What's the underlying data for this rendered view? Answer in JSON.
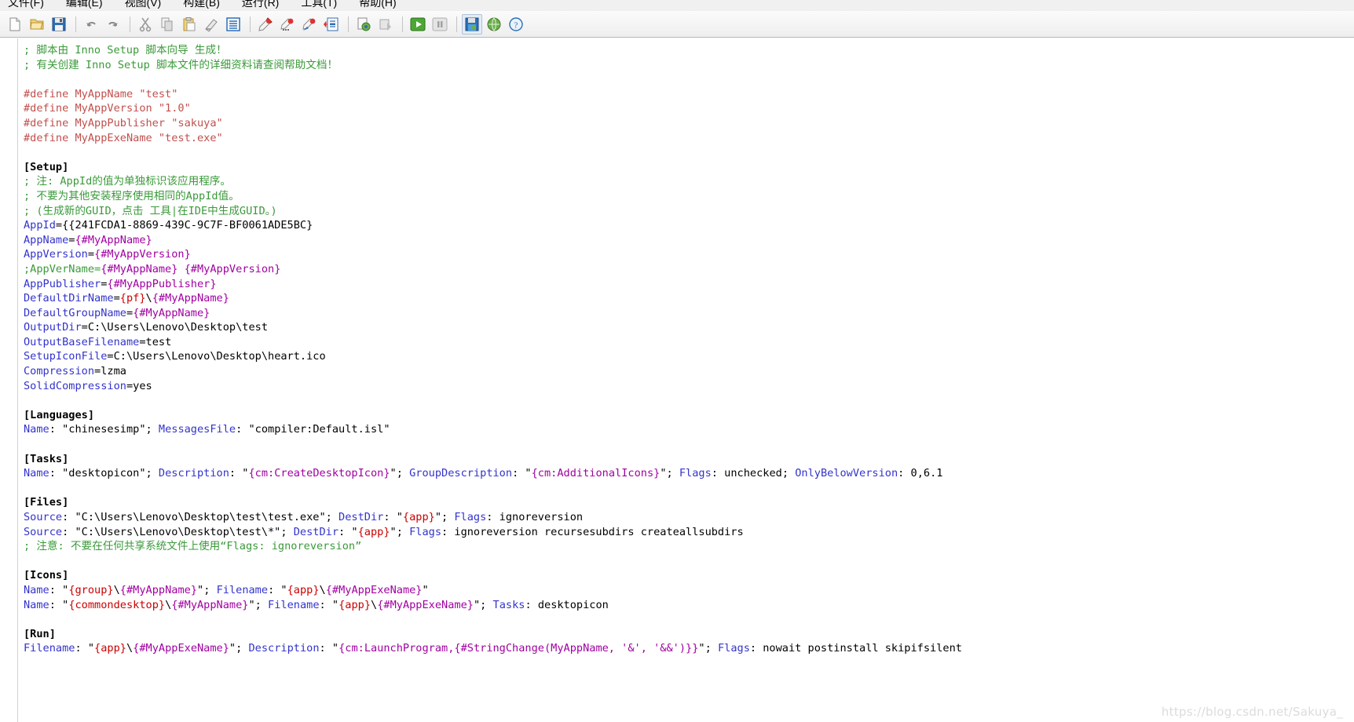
{
  "menubar": {
    "items": [
      {
        "name": "file",
        "label": "文件(F)"
      },
      {
        "name": "edit",
        "label": "编辑(E)"
      },
      {
        "name": "view",
        "label": "视图(V)"
      },
      {
        "name": "build",
        "label": "构建(B)"
      },
      {
        "name": "run",
        "label": "运行(R)"
      },
      {
        "name": "tools",
        "label": "工具(T)"
      },
      {
        "name": "help",
        "label": "帮助(H)"
      }
    ]
  },
  "toolbar": {
    "buttons": [
      {
        "name": "new-file-icon",
        "tip": "新建"
      },
      {
        "name": "open-folder-icon",
        "tip": "打开"
      },
      {
        "name": "save-icon",
        "tip": "保存"
      },
      {
        "name": "undo-icon",
        "tip": "撤销"
      },
      {
        "name": "redo-icon",
        "tip": "重做"
      },
      {
        "name": "cut-icon",
        "tip": "剪切"
      },
      {
        "name": "copy-icon",
        "tip": "复制"
      },
      {
        "name": "paste-icon",
        "tip": "粘贴"
      },
      {
        "name": "erase-icon",
        "tip": "删除"
      },
      {
        "name": "select-all-icon",
        "tip": "全选"
      },
      {
        "name": "find-icon",
        "tip": "查找"
      },
      {
        "name": "find-next-icon",
        "tip": "查找下一个"
      },
      {
        "name": "replace-icon",
        "tip": "替换"
      },
      {
        "name": "goto-line-icon",
        "tip": "转到行"
      },
      {
        "name": "compile-icon",
        "tip": "编译"
      },
      {
        "name": "stop-compile-icon",
        "tip": "停止编译"
      },
      {
        "name": "run-icon",
        "tip": "运行"
      },
      {
        "name": "pause-icon",
        "tip": "暂停"
      },
      {
        "name": "target-setup-icon",
        "tip": "生成安装程序"
      },
      {
        "name": "web-help-icon",
        "tip": "在线帮助"
      },
      {
        "name": "help-about-icon",
        "tip": "帮助"
      }
    ]
  },
  "watermark": "https://blog.csdn.net/Sakuya_",
  "editor": {
    "lines": [
      [
        {
          "t": "comment",
          "v": "; 脚本由 Inno Setup 脚本向导 生成！"
        }
      ],
      [
        {
          "t": "comment",
          "v": "; 有关创建 Inno Setup 脚本文件的详细资料请查阅帮助文档！"
        }
      ],
      [
        {
          "t": "plain",
          "v": ""
        }
      ],
      [
        {
          "t": "define",
          "v": "#define MyAppName \"test\""
        }
      ],
      [
        {
          "t": "define",
          "v": "#define MyAppVersion \"1.0\""
        }
      ],
      [
        {
          "t": "define",
          "v": "#define MyAppPublisher \"sakuya\""
        }
      ],
      [
        {
          "t": "define",
          "v": "#define MyAppExeName \"test.exe\""
        }
      ],
      [
        {
          "t": "plain",
          "v": ""
        }
      ],
      [
        {
          "t": "section",
          "v": "[Setup]"
        }
      ],
      [
        {
          "t": "comment",
          "v": "; 注: AppId的值为单独标识该应用程序。"
        }
      ],
      [
        {
          "t": "comment",
          "v": "; 不要为其他安装程序使用相同的AppId值。"
        }
      ],
      [
        {
          "t": "comment",
          "v": "; (生成新的GUID，点击 工具|在IDE中生成GUID。)"
        }
      ],
      [
        {
          "t": "key",
          "v": "AppId"
        },
        {
          "t": "plain",
          "v": "={{241FCDA1-8869-439C-9C7F-BF0061ADE5BC}"
        }
      ],
      [
        {
          "t": "key",
          "v": "AppName"
        },
        {
          "t": "plain",
          "v": "="
        },
        {
          "t": "const",
          "v": "{#MyAppName}"
        }
      ],
      [
        {
          "t": "key",
          "v": "AppVersion"
        },
        {
          "t": "plain",
          "v": "="
        },
        {
          "t": "const",
          "v": "{#MyAppVersion}"
        }
      ],
      [
        {
          "t": "comment",
          "v": ";AppVerName="
        },
        {
          "t": "const",
          "v": "{#MyAppName}"
        },
        {
          "t": "comment",
          "v": " "
        },
        {
          "t": "const",
          "v": "{#MyAppVersion}"
        }
      ],
      [
        {
          "t": "key",
          "v": "AppPublisher"
        },
        {
          "t": "plain",
          "v": "="
        },
        {
          "t": "const",
          "v": "{#MyAppPublisher}"
        }
      ],
      [
        {
          "t": "key",
          "v": "DefaultDirName"
        },
        {
          "t": "plain",
          "v": "="
        },
        {
          "t": "dir",
          "v": "{pf}"
        },
        {
          "t": "plain",
          "v": "\\"
        },
        {
          "t": "const",
          "v": "{#MyAppName}"
        }
      ],
      [
        {
          "t": "key",
          "v": "DefaultGroupName"
        },
        {
          "t": "plain",
          "v": "="
        },
        {
          "t": "const",
          "v": "{#MyAppName}"
        }
      ],
      [
        {
          "t": "key",
          "v": "OutputDir"
        },
        {
          "t": "plain",
          "v": "=C:\\Users\\Lenovo\\Desktop\\test"
        }
      ],
      [
        {
          "t": "key",
          "v": "OutputBaseFilename"
        },
        {
          "t": "plain",
          "v": "=test"
        }
      ],
      [
        {
          "t": "key",
          "v": "SetupIconFile"
        },
        {
          "t": "plain",
          "v": "=C:\\Users\\Lenovo\\Desktop\\heart.ico"
        }
      ],
      [
        {
          "t": "key",
          "v": "Compression"
        },
        {
          "t": "plain",
          "v": "=lzma"
        }
      ],
      [
        {
          "t": "key",
          "v": "SolidCompression"
        },
        {
          "t": "plain",
          "v": "=yes"
        }
      ],
      [
        {
          "t": "plain",
          "v": ""
        }
      ],
      [
        {
          "t": "section",
          "v": "[Languages]"
        }
      ],
      [
        {
          "t": "key",
          "v": "Name"
        },
        {
          "t": "plain",
          "v": ": \"chinesesimp\"; "
        },
        {
          "t": "key",
          "v": "MessagesFile"
        },
        {
          "t": "plain",
          "v": ": \"compiler:Default.isl\""
        }
      ],
      [
        {
          "t": "plain",
          "v": ""
        }
      ],
      [
        {
          "t": "section",
          "v": "[Tasks]"
        }
      ],
      [
        {
          "t": "key",
          "v": "Name"
        },
        {
          "t": "plain",
          "v": ": \"desktopicon\"; "
        },
        {
          "t": "key",
          "v": "Description"
        },
        {
          "t": "plain",
          "v": ": \""
        },
        {
          "t": "const",
          "v": "{cm:CreateDesktopIcon}"
        },
        {
          "t": "plain",
          "v": "\"; "
        },
        {
          "t": "key",
          "v": "GroupDescription"
        },
        {
          "t": "plain",
          "v": ": \""
        },
        {
          "t": "const",
          "v": "{cm:AdditionalIcons}"
        },
        {
          "t": "plain",
          "v": "\"; "
        },
        {
          "t": "key",
          "v": "Flags"
        },
        {
          "t": "plain",
          "v": ": unchecked; "
        },
        {
          "t": "key",
          "v": "OnlyBelowVersion"
        },
        {
          "t": "plain",
          "v": ": 0,6.1"
        }
      ],
      [
        {
          "t": "plain",
          "v": ""
        }
      ],
      [
        {
          "t": "section",
          "v": "[Files]"
        }
      ],
      [
        {
          "t": "key",
          "v": "Source"
        },
        {
          "t": "plain",
          "v": ": \"C:\\Users\\Lenovo\\Desktop\\test\\test.exe\"; "
        },
        {
          "t": "key",
          "v": "DestDir"
        },
        {
          "t": "plain",
          "v": ": \""
        },
        {
          "t": "dir",
          "v": "{app}"
        },
        {
          "t": "plain",
          "v": "\"; "
        },
        {
          "t": "key",
          "v": "Flags"
        },
        {
          "t": "plain",
          "v": ": ignoreversion"
        }
      ],
      [
        {
          "t": "key",
          "v": "Source"
        },
        {
          "t": "plain",
          "v": ": \"C:\\Users\\Lenovo\\Desktop\\test\\*\"; "
        },
        {
          "t": "key",
          "v": "DestDir"
        },
        {
          "t": "plain",
          "v": ": \""
        },
        {
          "t": "dir",
          "v": "{app}"
        },
        {
          "t": "plain",
          "v": "\"; "
        },
        {
          "t": "key",
          "v": "Flags"
        },
        {
          "t": "plain",
          "v": ": ignoreversion recursesubdirs createallsubdirs"
        }
      ],
      [
        {
          "t": "comment",
          "v": "; 注意: 不要在任何共享系统文件上使用“Flags: ignoreversion”"
        }
      ],
      [
        {
          "t": "plain",
          "v": ""
        }
      ],
      [
        {
          "t": "section",
          "v": "[Icons]"
        }
      ],
      [
        {
          "t": "key",
          "v": "Name"
        },
        {
          "t": "plain",
          "v": ": \""
        },
        {
          "t": "dir",
          "v": "{group}"
        },
        {
          "t": "plain",
          "v": "\\"
        },
        {
          "t": "const",
          "v": "{#MyAppName}"
        },
        {
          "t": "plain",
          "v": "\"; "
        },
        {
          "t": "key",
          "v": "Filename"
        },
        {
          "t": "plain",
          "v": ": \""
        },
        {
          "t": "dir",
          "v": "{app}"
        },
        {
          "t": "plain",
          "v": "\\"
        },
        {
          "t": "const",
          "v": "{#MyAppExeName}"
        },
        {
          "t": "plain",
          "v": "\""
        }
      ],
      [
        {
          "t": "key",
          "v": "Name"
        },
        {
          "t": "plain",
          "v": ": \""
        },
        {
          "t": "dir",
          "v": "{commondesktop}"
        },
        {
          "t": "plain",
          "v": "\\"
        },
        {
          "t": "const",
          "v": "{#MyAppName}"
        },
        {
          "t": "plain",
          "v": "\"; "
        },
        {
          "t": "key",
          "v": "Filename"
        },
        {
          "t": "plain",
          "v": ": \""
        },
        {
          "t": "dir",
          "v": "{app}"
        },
        {
          "t": "plain",
          "v": "\\"
        },
        {
          "t": "const",
          "v": "{#MyAppExeName}"
        },
        {
          "t": "plain",
          "v": "\"; "
        },
        {
          "t": "key",
          "v": "Tasks"
        },
        {
          "t": "plain",
          "v": ": desktopicon"
        }
      ],
      [
        {
          "t": "plain",
          "v": ""
        }
      ],
      [
        {
          "t": "section",
          "v": "[Run]"
        }
      ],
      [
        {
          "t": "key",
          "v": "Filename"
        },
        {
          "t": "plain",
          "v": ": \""
        },
        {
          "t": "dir",
          "v": "{app}"
        },
        {
          "t": "plain",
          "v": "\\"
        },
        {
          "t": "const",
          "v": "{#MyAppExeName}"
        },
        {
          "t": "plain",
          "v": "\"; "
        },
        {
          "t": "key",
          "v": "Description"
        },
        {
          "t": "plain",
          "v": ": \""
        },
        {
          "t": "const",
          "v": "{cm:LaunchProgram,{#StringChange(MyAppName, '&', '&&')}}"
        },
        {
          "t": "plain",
          "v": "\"; "
        },
        {
          "t": "key",
          "v": "Flags"
        },
        {
          "t": "plain",
          "v": ": nowait postinstall skipifsilent"
        }
      ]
    ]
  },
  "colors": {
    "comment": "#3a9a3a",
    "define": "#c0504d",
    "keyword": "#3333cc",
    "constant": "#a000a0",
    "directive": "#cc0000",
    "section": "#000000",
    "background": "#ffffff"
  }
}
